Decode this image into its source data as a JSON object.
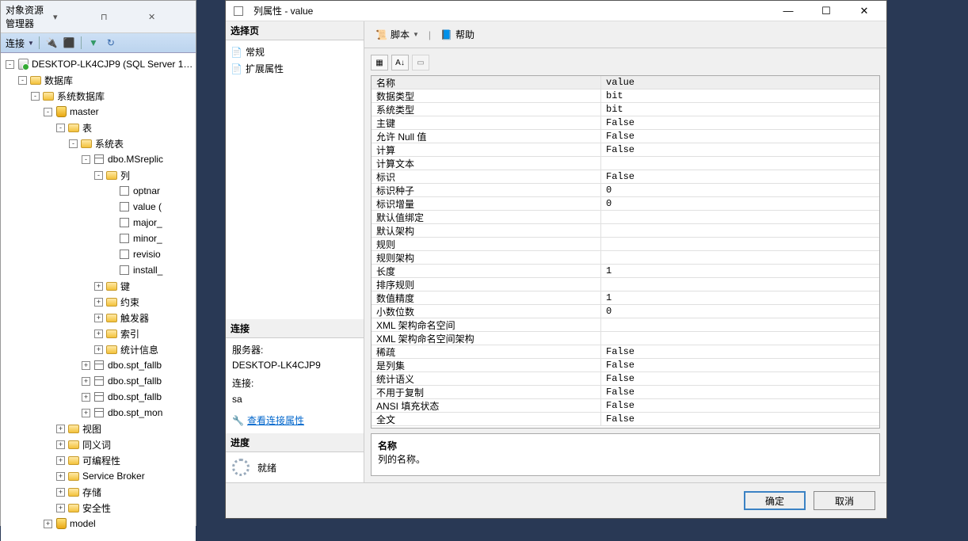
{
  "status_bar": "就绪",
  "explorer": {
    "title": "对象资源管理器",
    "connect_label": "连接",
    "tree": [
      {
        "d": 0,
        "exp": "-",
        "icon": "srv",
        "label": "DESKTOP-LK4CJP9 (SQL Server 1…"
      },
      {
        "d": 1,
        "exp": "-",
        "icon": "folder",
        "label": "数据库"
      },
      {
        "d": 2,
        "exp": "-",
        "icon": "folder",
        "label": "系统数据库"
      },
      {
        "d": 3,
        "exp": "-",
        "icon": "db",
        "label": "master"
      },
      {
        "d": 4,
        "exp": "-",
        "icon": "folder",
        "label": "表"
      },
      {
        "d": 5,
        "exp": "-",
        "icon": "folder",
        "label": "系统表"
      },
      {
        "d": 6,
        "exp": "-",
        "icon": "tbl",
        "label": "dbo.MSreplic"
      },
      {
        "d": 7,
        "exp": "-",
        "icon": "folder",
        "label": "列"
      },
      {
        "d": 8,
        "exp": "",
        "icon": "col",
        "label": "optnar"
      },
      {
        "d": 8,
        "exp": "",
        "icon": "col",
        "label": "value ("
      },
      {
        "d": 8,
        "exp": "",
        "icon": "col",
        "label": "major_"
      },
      {
        "d": 8,
        "exp": "",
        "icon": "col",
        "label": "minor_"
      },
      {
        "d": 8,
        "exp": "",
        "icon": "col",
        "label": "revisio"
      },
      {
        "d": 8,
        "exp": "",
        "icon": "col",
        "label": "install_"
      },
      {
        "d": 7,
        "exp": "+",
        "icon": "folder",
        "label": "键"
      },
      {
        "d": 7,
        "exp": "+",
        "icon": "folder",
        "label": "约束"
      },
      {
        "d": 7,
        "exp": "+",
        "icon": "folder",
        "label": "触发器"
      },
      {
        "d": 7,
        "exp": "+",
        "icon": "folder",
        "label": "索引"
      },
      {
        "d": 7,
        "exp": "+",
        "icon": "folder",
        "label": "统计信息"
      },
      {
        "d": 6,
        "exp": "+",
        "icon": "tbl",
        "label": "dbo.spt_fallb"
      },
      {
        "d": 6,
        "exp": "+",
        "icon": "tbl",
        "label": "dbo.spt_fallb"
      },
      {
        "d": 6,
        "exp": "+",
        "icon": "tbl",
        "label": "dbo.spt_fallb"
      },
      {
        "d": 6,
        "exp": "+",
        "icon": "tbl",
        "label": "dbo.spt_mon"
      },
      {
        "d": 4,
        "exp": "+",
        "icon": "folder",
        "label": "视图"
      },
      {
        "d": 4,
        "exp": "+",
        "icon": "folder",
        "label": "同义词"
      },
      {
        "d": 4,
        "exp": "+",
        "icon": "folder",
        "label": "可编程性"
      },
      {
        "d": 4,
        "exp": "+",
        "icon": "folder",
        "label": "Service Broker"
      },
      {
        "d": 4,
        "exp": "+",
        "icon": "folder",
        "label": "存储"
      },
      {
        "d": 4,
        "exp": "+",
        "icon": "folder",
        "label": "安全性"
      },
      {
        "d": 3,
        "exp": "+",
        "icon": "db",
        "label": "model"
      }
    ]
  },
  "dialog": {
    "title": "列属性 - value",
    "select_page": "选择页",
    "pages": [
      "常规",
      "扩展属性"
    ],
    "script_btn": "脚本",
    "help_btn": "帮助",
    "connection_hdr": "连接",
    "server_label": "服务器:",
    "server_value": "DESKTOP-LK4CJP9",
    "conn_label": "连接:",
    "conn_value": "sa",
    "view_conn": "查看连接属性",
    "progress_hdr": "进度",
    "progress_value": "就绪",
    "properties": [
      {
        "k": "名称",
        "v": "value",
        "hdr": true
      },
      {
        "k": "数据类型",
        "v": "bit"
      },
      {
        "k": "系统类型",
        "v": "bit"
      },
      {
        "k": "主键",
        "v": "False"
      },
      {
        "k": "允许 Null 值",
        "v": "False"
      },
      {
        "k": "计算",
        "v": "False"
      },
      {
        "k": "计算文本",
        "v": ""
      },
      {
        "k": "标识",
        "v": "False"
      },
      {
        "k": "标识种子",
        "v": "0"
      },
      {
        "k": "标识增量",
        "v": "0"
      },
      {
        "k": "默认值绑定",
        "v": ""
      },
      {
        "k": "默认架构",
        "v": ""
      },
      {
        "k": "规则",
        "v": ""
      },
      {
        "k": "规则架构",
        "v": ""
      },
      {
        "k": "长度",
        "v": "1"
      },
      {
        "k": "排序规则",
        "v": ""
      },
      {
        "k": "数值精度",
        "v": "1"
      },
      {
        "k": "小数位数",
        "v": "0"
      },
      {
        "k": "XML 架构命名空间",
        "v": ""
      },
      {
        "k": "XML 架构命名空间架构",
        "v": ""
      },
      {
        "k": "稀疏",
        "v": "False"
      },
      {
        "k": "是列集",
        "v": "False"
      },
      {
        "k": "统计语义",
        "v": "False"
      },
      {
        "k": "不用于复制",
        "v": "False"
      },
      {
        "k": "ANSI 填充状态",
        "v": "False"
      },
      {
        "k": "全文",
        "v": "False"
      }
    ],
    "desc_name": "名称",
    "desc_text": "列的名称。",
    "ok": "确定",
    "cancel": "取消"
  }
}
